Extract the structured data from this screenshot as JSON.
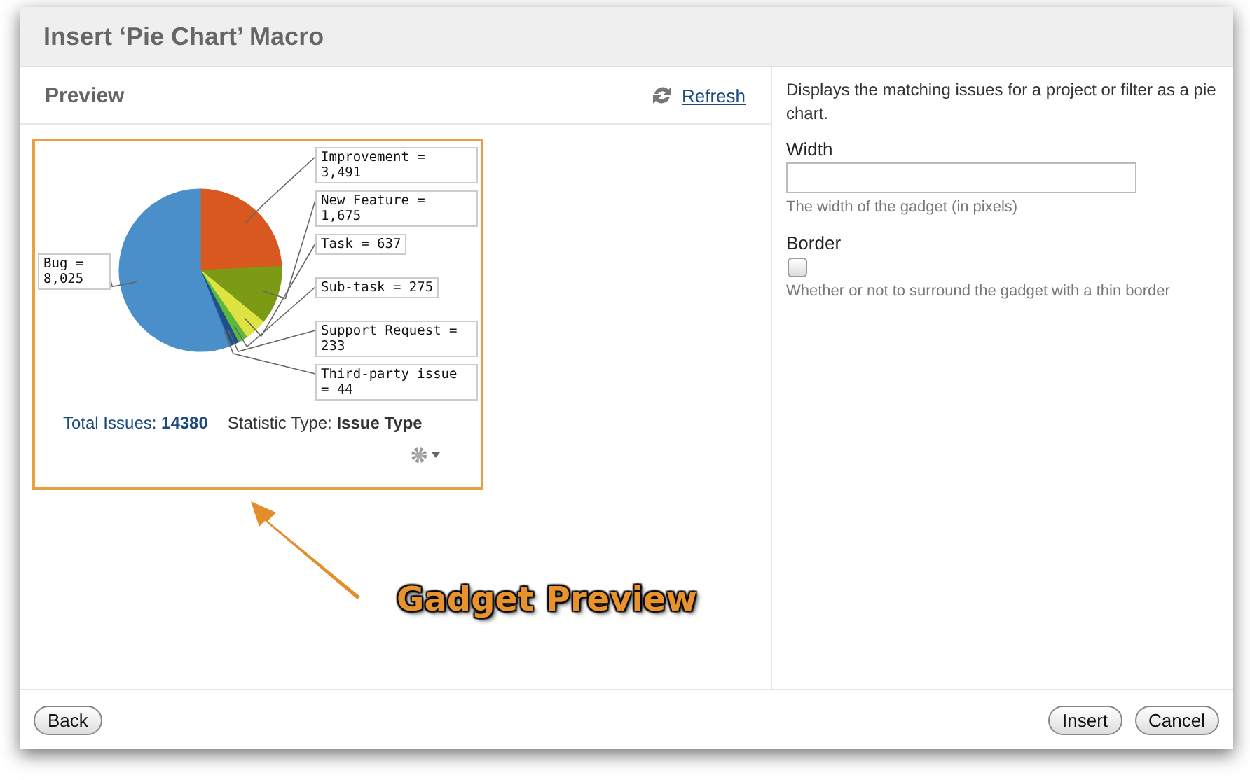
{
  "dialog": {
    "title": "Insert ‘Pie Chart’ Macro"
  },
  "preview": {
    "heading": "Preview",
    "refresh_link": "Refresh",
    "gadget": {
      "chart_data": {
        "type": "pie",
        "values": [
          3491,
          1675,
          637,
          275,
          233,
          44,
          8025
        ],
        "value_labels": [
          "Improvement = 3,491",
          "New Feature = 1,675",
          "Task = 637",
          "Sub-task = 275",
          "Support Request = 233",
          "Third-party issue = 44",
          "Bug = 8,025"
        ]
      },
      "slices": [
        {
          "color": "#d8581f"
        },
        {
          "color": "#7a9b13"
        },
        {
          "color": "#dfe342"
        },
        {
          "color": "#5bb83d"
        },
        {
          "color": "#1d4f8c"
        },
        {
          "color": "#2f86c4"
        },
        {
          "color": "#4a8fc9"
        }
      ],
      "total_issues": "Total Issues: **14380**",
      "statistic_type": "Statistic Type: **Issue Type**"
    },
    "annotation": "Gadget Preview"
  },
  "settings": {
    "description": "Displays the matching issues for a project or filter as a pie chart.",
    "fields": [
      {
        "kind": "text",
        "label": "Width",
        "hint": "The width of the gadget (in pixels)"
      },
      {
        "kind": "checkbox",
        "label": "Border",
        "checked": false,
        "hint": "Whether or not to surround the gadget with a thin border"
      }
    ]
  },
  "footer": {
    "left_buttons": [
      "Back"
    ],
    "right_buttons": [
      "Insert",
      "Cancel"
    ]
  }
}
